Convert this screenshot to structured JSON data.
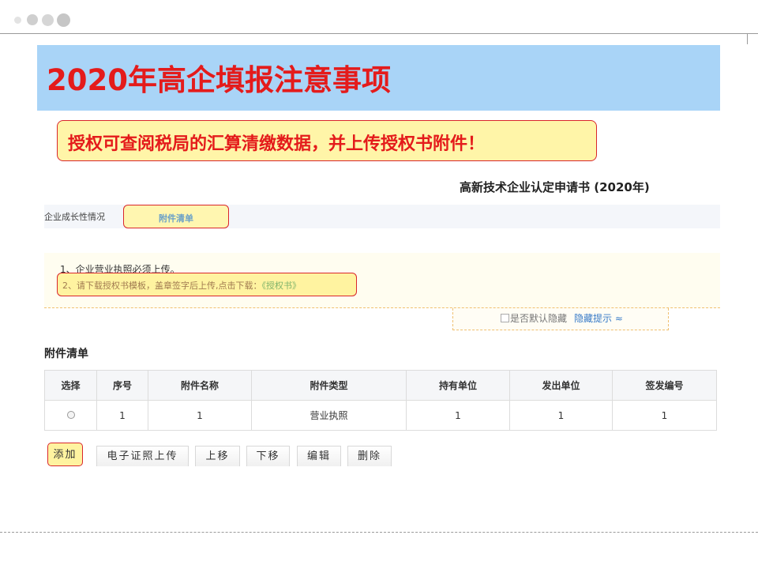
{
  "slide": {
    "title": "2020年高企填报注意事项",
    "callout": "授权可查阅税局的汇算清缴数据，并上传授权书附件！"
  },
  "form": {
    "title": "高新技术企业认定申请书 (2020年)",
    "tabs": [
      {
        "label": "企业成长性情况",
        "active": false
      },
      {
        "label": "附件清单",
        "active": true
      }
    ],
    "notice": {
      "line1": "1、企业营业执照必须上传。",
      "line2_text": "2、请下载授权书模板，盖章签字后上传,点击下载：",
      "line2_link": "《授权书》"
    },
    "hide_toggle": {
      "label": "是否默认隐藏",
      "link": "隐藏提示 ≈"
    },
    "section_title": "附件清单",
    "table": {
      "headers": [
        "选择",
        "序号",
        "附件名称",
        "附件类型",
        "持有单位",
        "发出单位",
        "签发编号"
      ],
      "rows": [
        {
          "selected": false,
          "index": "1",
          "name": "1",
          "type": "营业执照",
          "holder": "1",
          "issuer": "1",
          "number": "1"
        }
      ]
    },
    "buttons": {
      "add": "添加",
      "upload": "电子证照上传",
      "up": "上移",
      "down": "下移",
      "edit": "编辑",
      "delete": "删除"
    }
  },
  "colors": {
    "banner": "#a9d4f7",
    "title_red": "#e41b1b",
    "callout_fill": "#fff5a8",
    "link_blue": "#3a7cc8"
  }
}
